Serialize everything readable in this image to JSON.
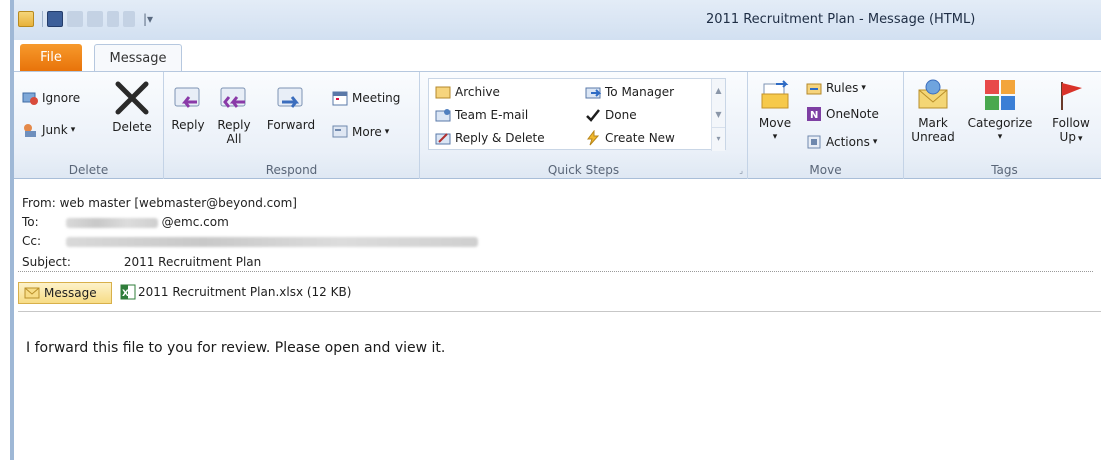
{
  "window": {
    "title": "2011 Recruitment Plan - Message (HTML)"
  },
  "tabs": {
    "file": "File",
    "message": "Message"
  },
  "ribbon": {
    "delete": {
      "label": "Delete",
      "ignore": "Ignore",
      "junk": "Junk",
      "delete_btn": "Delete"
    },
    "respond": {
      "label": "Respond",
      "reply": "Reply",
      "reply_all_1": "Reply",
      "reply_all_2": "All",
      "forward": "Forward",
      "meeting": "Meeting",
      "more": "More"
    },
    "quick_steps": {
      "label": "Quick Steps",
      "archive": "Archive",
      "team_email": "Team E-mail",
      "reply_delete": "Reply & Delete",
      "to_manager": "To Manager",
      "done": "Done",
      "create_new": "Create New"
    },
    "move": {
      "label": "Move",
      "move_btn": "Move",
      "rules": "Rules",
      "onenote": "OneNote",
      "actions": "Actions"
    },
    "tags": {
      "label": "Tags",
      "mark_unread_1": "Mark",
      "mark_unread_2": "Unread",
      "categorize": "Categorize",
      "follow_up_1": "Follow",
      "follow_up_2": "Up"
    }
  },
  "headers": {
    "from_label": "From:",
    "from_value": "web master [webmaster@beyond.com]",
    "to_label": "To:",
    "to_value": "@emc.com",
    "cc_label": "Cc:",
    "subject_label": "Subject:",
    "subject_value": "2011 Recruitment Plan"
  },
  "attachments": {
    "message_tab": "Message",
    "file": "2011 Recruitment Plan.xlsx (12 KB)"
  },
  "body": {
    "text": "I forward this file to you for review.  Please open and view it."
  },
  "colors": {
    "file_tab": "#e8730a",
    "ribbon_bg": "#eaf0f8",
    "title_bar": "#d2e0f1"
  }
}
